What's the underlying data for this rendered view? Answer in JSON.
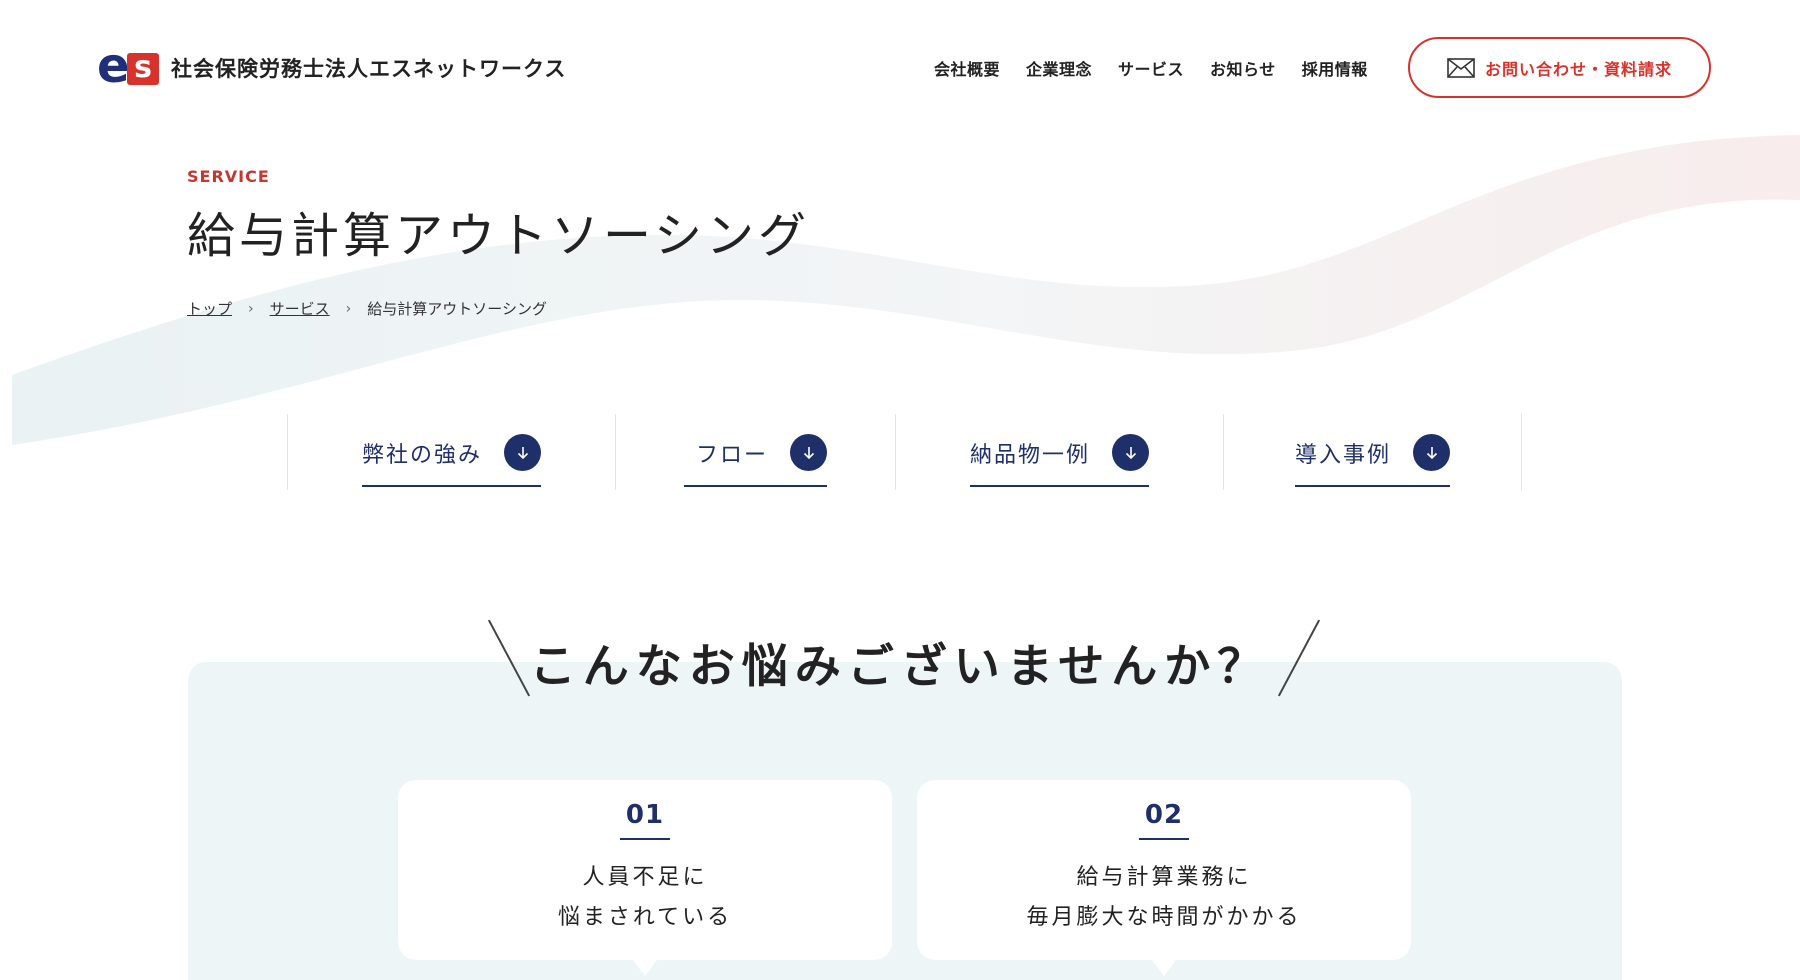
{
  "header": {
    "logo_text": "社会保険労務士法人エスネットワークス",
    "logo_mark_e": "e",
    "logo_mark_s": "s",
    "nav": [
      "会社概要",
      "企業理念",
      "サービス",
      "お知らせ",
      "採用情報"
    ],
    "contact_label": "お問い合わせ・資料請求"
  },
  "hero": {
    "eyebrow": "SERVICE",
    "title": "給与計算アウトソーシング",
    "breadcrumb": [
      "トップ",
      "サービス",
      "給与計算アウトソーシング"
    ],
    "breadcrumb_sep": "›"
  },
  "anchors": [
    {
      "label": "弊社の強み"
    },
    {
      "label": "フロー"
    },
    {
      "label": "納品物一例"
    },
    {
      "label": "導入事例"
    }
  ],
  "worries": {
    "title": "こんなお悩みございませんか？",
    "cards": [
      {
        "num": "01",
        "line1": "人員不足に",
        "line2": "悩まされている"
      },
      {
        "num": "02",
        "line1": "給与計算業務に",
        "line2": "毎月膨大な時間がかかる"
      }
    ]
  },
  "colors": {
    "accent_red": "#d7332c",
    "navy": "#1f2f6a",
    "section_bg": "#eef5f7"
  }
}
